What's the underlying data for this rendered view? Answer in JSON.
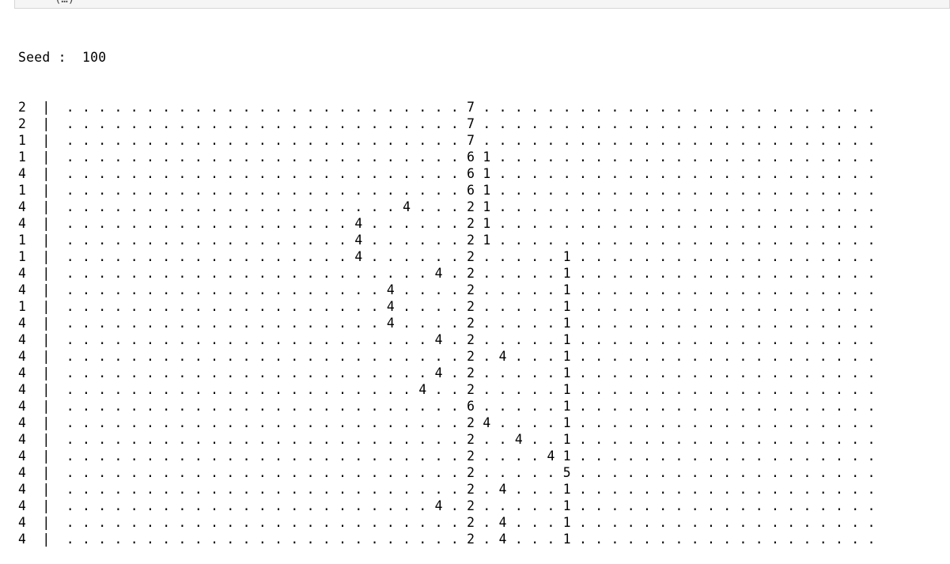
{
  "cell": {
    "top_strip_text": "(…)"
  },
  "output": {
    "seed_label": "Seed :",
    "seed_value": "100",
    "rows": [
      "2  |  . . . . . . . . . . . . . . . . . . . . . . . . . 7 . . . . . . . . . . . . . . . . . . . . . . . . .",
      "2  |  . . . . . . . . . . . . . . . . . . . . . . . . . 7 . . . . . . . . . . . . . . . . . . . . . . . . .",
      "1  |  . . . . . . . . . . . . . . . . . . . . . . . . . 7 . . . . . . . . . . . . . . . . . . . . . . . . .",
      "1  |  . . . . . . . . . . . . . . . . . . . . . . . . . 6 1 . . . . . . . . . . . . . . . . . . . . . . . .",
      "4  |  . . . . . . . . . . . . . . . . . . . . . . . . . 6 1 . . . . . . . . . . . . . . . . . . . . . . . .",
      "1  |  . . . . . . . . . . . . . . . . . . . . . . . . . 6 1 . . . . . . . . . . . . . . . . . . . . . . . .",
      "4  |  . . . . . . . . . . . . . . . . . . . . . 4 . . . 2 1 . . . . . . . . . . . . . . . . . . . . . . . .",
      "4  |  . . . . . . . . . . . . . . . . . . 4 . . . . . . 2 1 . . . . . . . . . . . . . . . . . . . . . . . .",
      "1  |  . . . . . . . . . . . . . . . . . . 4 . . . . . . 2 1 . . . . . . . . . . . . . . . . . . . . . . . .",
      "1  |  . . . . . . . . . . . . . . . . . . 4 . . . . . . 2 . . . . . 1 . . . . . . . . . . . . . . . . . . .",
      "4  |  . . . . . . . . . . . . . . . . . . . . . . . 4 . 2 . . . . . 1 . . . . . . . . . . . . . . . . . . .",
      "4  |  . . . . . . . . . . . . . . . . . . . . 4 . . . . 2 . . . . . 1 . . . . . . . . . . . . . . . . . . .",
      "1  |  . . . . . . . . . . . . . . . . . . . . 4 . . . . 2 . . . . . 1 . . . . . . . . . . . . . . . . . . .",
      "4  |  . . . . . . . . . . . . . . . . . . . . 4 . . . . 2 . . . . . 1 . . . . . . . . . . . . . . . . . . .",
      "4  |  . . . . . . . . . . . . . . . . . . . . . . . 4 . 2 . . . . . 1 . . . . . . . . . . . . . . . . . . .",
      "4  |  . . . . . . . . . . . . . . . . . . . . . . . . . 2 . 4 . . . 1 . . . . . . . . . . . . . . . . . . .",
      "4  |  . . . . . . . . . . . . . . . . . . . . . . . 4 . 2 . . . . . 1 . . . . . . . . . . . . . . . . . . .",
      "4  |  . . . . . . . . . . . . . . . . . . . . . . 4 . . 2 . . . . . 1 . . . . . . . . . . . . . . . . . . .",
      "4  |  . . . . . . . . . . . . . . . . . . . . . . . . . 6 . . . . . 1 . . . . . . . . . . . . . . . . . . .",
      "4  |  . . . . . . . . . . . . . . . . . . . . . . . . . 2 4 . . . . 1 . . . . . . . . . . . . . . . . . . .",
      "4  |  . . . . . . . . . . . . . . . . . . . . . . . . . 2 . . 4 . . 1 . . . . . . . . . . . . . . . . . . .",
      "4  |  . . . . . . . . . . . . . . . . . . . . . . . . . 2 . . . . 4 1 . . . . . . . . . . . . . . . . . . .",
      "4  |  . . . . . . . . . . . . . . . . . . . . . . . . . 2 . . . . . 5 . . . . . . . . . . . . . . . . . . .",
      "4  |  . . . . . . . . . . . . . . . . . . . . . . . . . 2 . 4 . . . 1 . . . . . . . . . . . . . . . . . . .",
      "4  |  . . . . . . . . . . . . . . . . . . . . . . . 4 . 2 . . . . . 1 . . . . . . . . . . . . . . . . . . .",
      "4  |  . . . . . . . . . . . . . . . . . . . . . . . . . 2 . 4 . . . 1 . . . . . . . . . . . . . . . . . . .",
      "4  |  . . . . . . . . . . . . . . . . . . . . . . . . . 2 . 4 . . . 1 . . . . . . . . . . . . . . . . . . ."
    ]
  }
}
